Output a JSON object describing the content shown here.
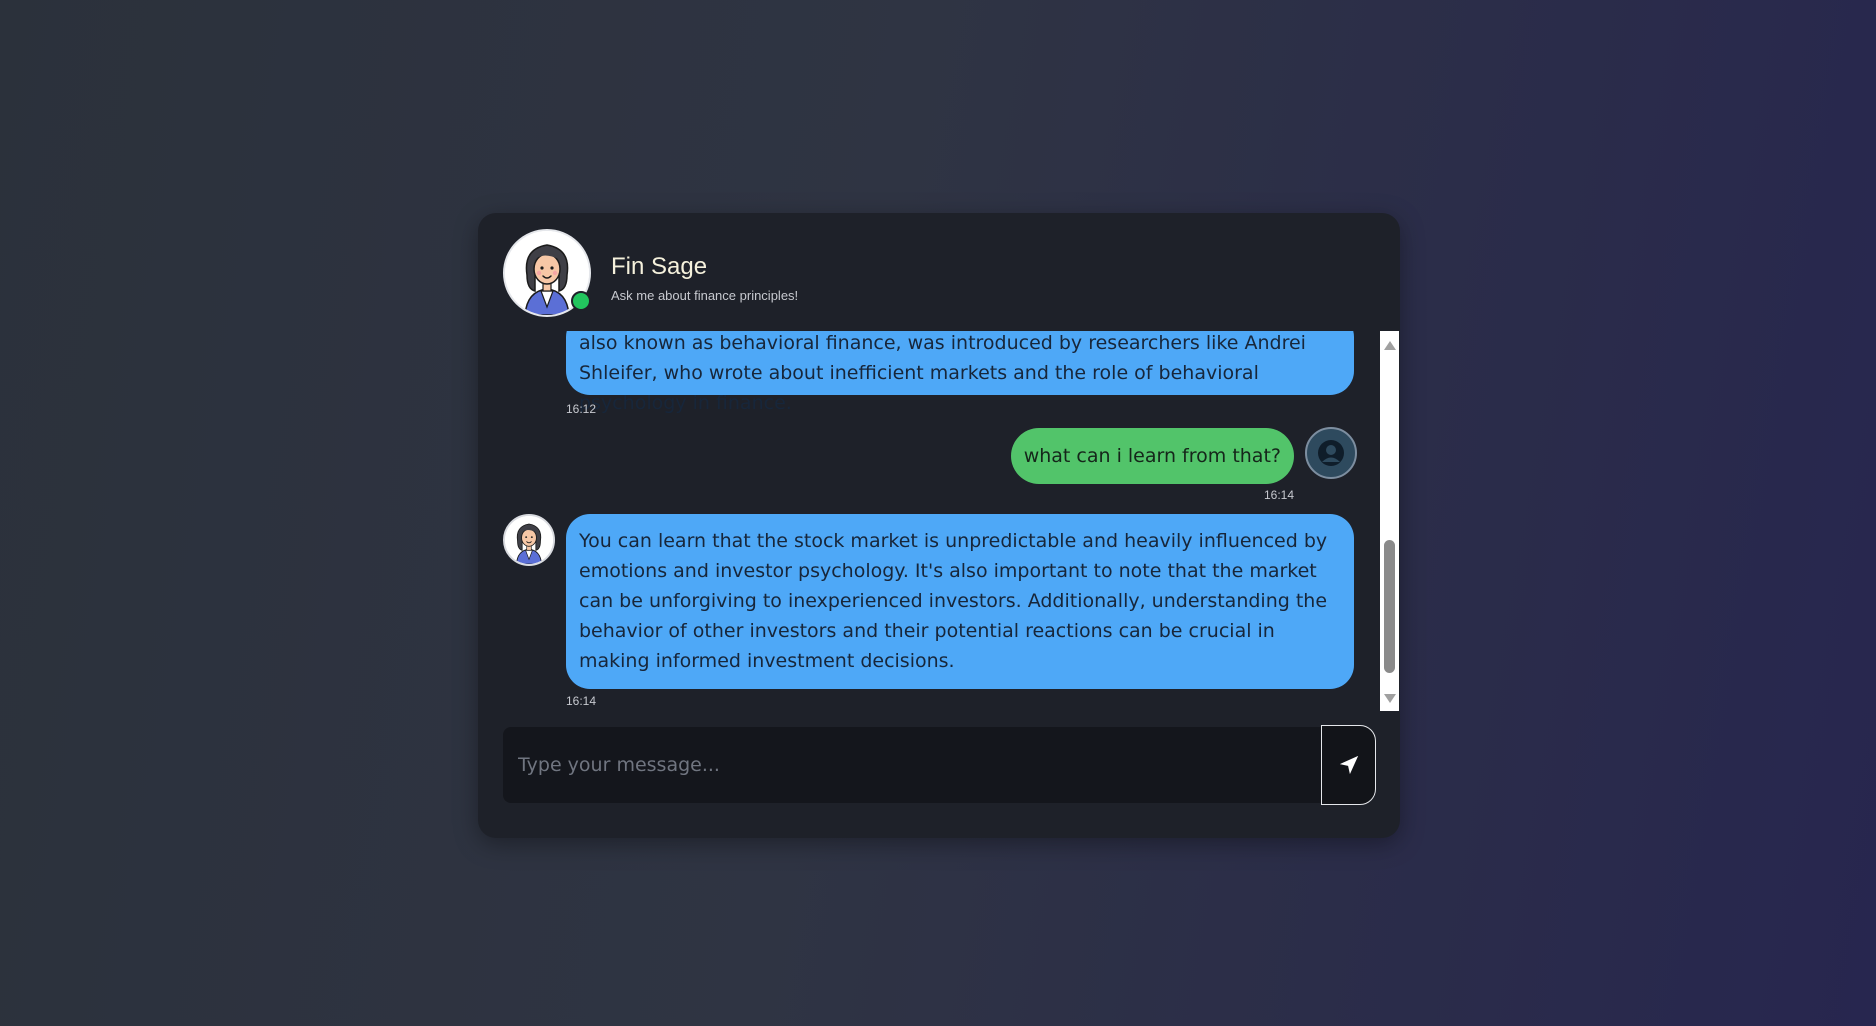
{
  "header": {
    "name": "Fin Sage",
    "status": "Ask me about finance principles!",
    "avatar_icon": "female-advisor-avatar-icon",
    "online_color": "#22c55e"
  },
  "messages": [
    {
      "sender": "bot",
      "text": "also known as behavioral finance, was introduced by researchers like Andrei Shleifer, who wrote about inefficient markets and the role of behavioral psychology in finance.",
      "time": "16:12"
    },
    {
      "sender": "user",
      "text": "what can i learn from that?",
      "time": "16:14"
    },
    {
      "sender": "bot",
      "text": "You can learn that the stock market is unpredictable and heavily influenced by emotions and investor psychology. It's also important to note that the market can be unforgiving to inexperienced investors. Additionally, understanding the behavior of other investors and their potential reactions can be crucial in making informed investment decisions.",
      "time": "16:14"
    }
  ],
  "input": {
    "placeholder": "Type your message..."
  },
  "send_button": {
    "icon": "send-arrow-icon"
  },
  "colors": {
    "bot_bubble": "#4ea8f7",
    "user_bubble": "#52c46a",
    "card": "#1e2129"
  }
}
